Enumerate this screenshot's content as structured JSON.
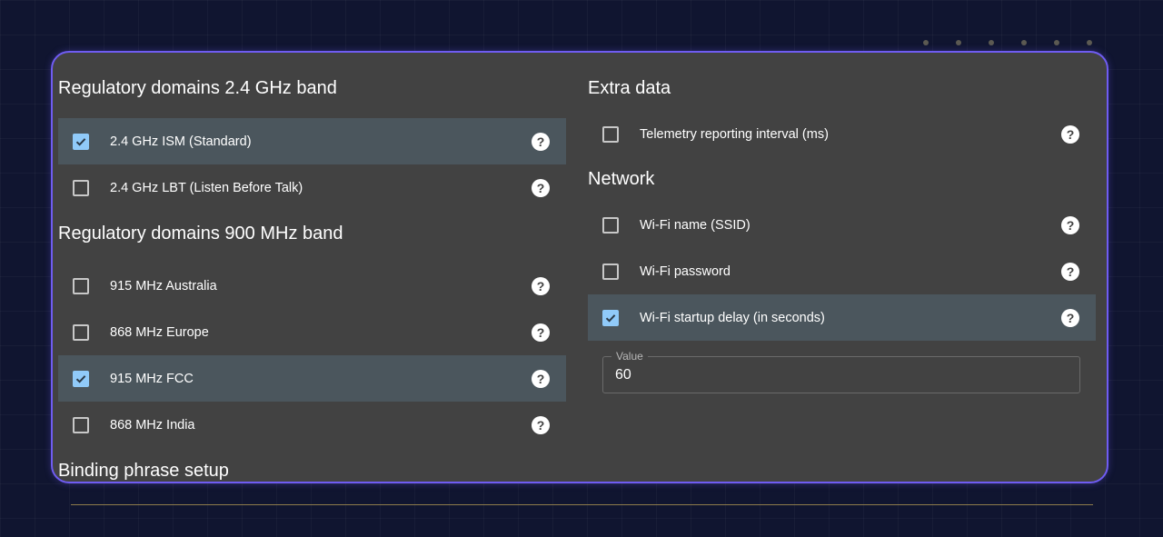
{
  "left": {
    "band24": {
      "title": "Regulatory domains 2.4 GHz band",
      "options": [
        {
          "label": "2.4 GHz ISM (Standard)",
          "checked": true
        },
        {
          "label": "2.4 GHz LBT (Listen Before Talk)",
          "checked": false
        }
      ]
    },
    "band900": {
      "title": "Regulatory domains 900 MHz band",
      "options": [
        {
          "label": "915 MHz Australia",
          "checked": false
        },
        {
          "label": "868 MHz Europe",
          "checked": false
        },
        {
          "label": "915 MHz FCC",
          "checked": true
        },
        {
          "label": "868 MHz India",
          "checked": false
        }
      ]
    },
    "binding": {
      "title": "Binding phrase setup"
    }
  },
  "right": {
    "extra": {
      "title": "Extra data",
      "options": [
        {
          "label": "Telemetry reporting interval (ms)",
          "checked": false
        }
      ]
    },
    "network": {
      "title": "Network",
      "options": [
        {
          "label": "Wi-Fi name (SSID)",
          "checked": false
        },
        {
          "label": "Wi-Fi password",
          "checked": false
        },
        {
          "label": "Wi-Fi startup delay (in seconds)",
          "checked": true
        }
      ],
      "value_field": {
        "label": "Value",
        "value": "60"
      }
    }
  },
  "icons": {
    "help": "help-circle-icon",
    "check": "check-icon"
  },
  "colors": {
    "panel_bg": "#424242",
    "panel_border": "#6f5cf2",
    "checked_row_bg": "#4b565d",
    "checkbox_on": "#90caf9",
    "page_bg": "#101530"
  }
}
